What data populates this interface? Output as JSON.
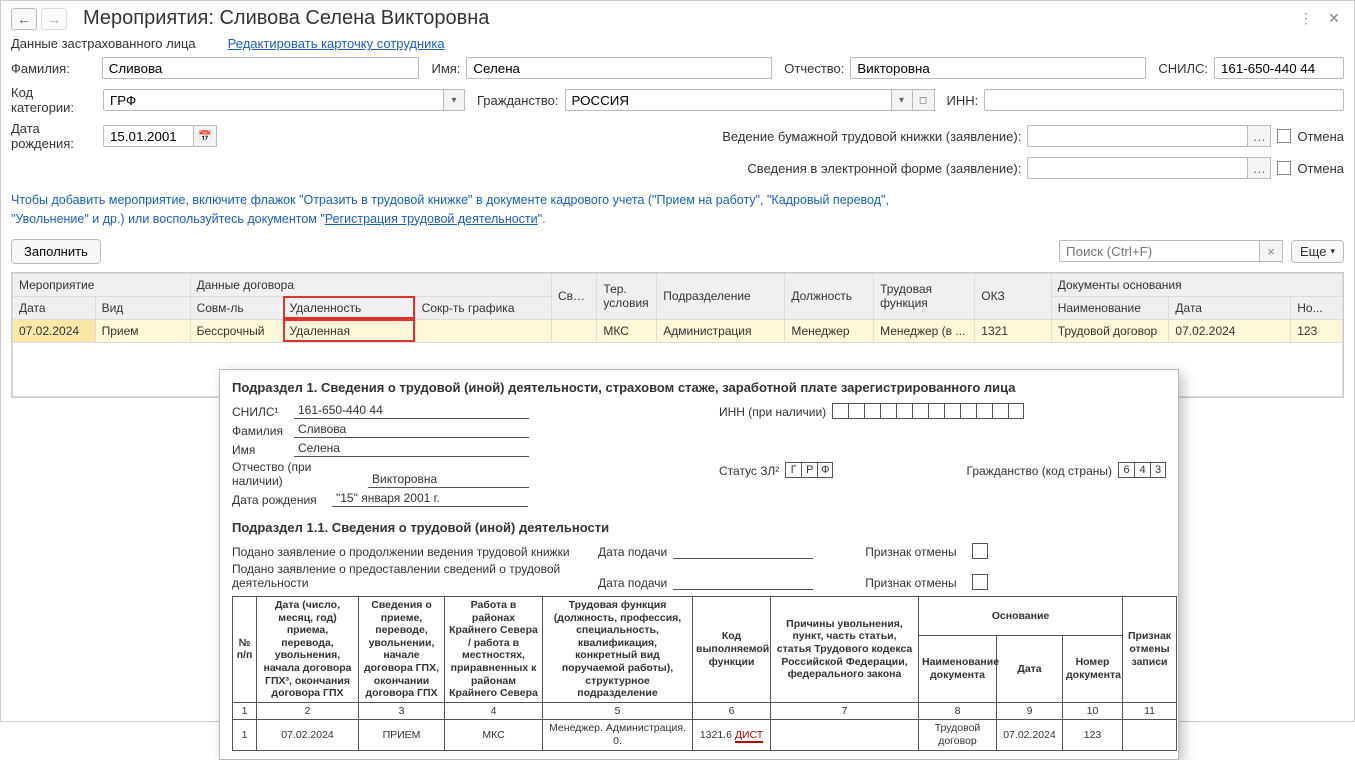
{
  "header": {
    "title": "Мероприятия: Сливова Селена Викторовна"
  },
  "insured": {
    "section_label": "Данные застрахованного лица",
    "edit_link": "Редактировать карточку сотрудника",
    "surname_label": "Фамилия:",
    "surname": "Сливова",
    "name_label": "Имя:",
    "name": "Селена",
    "patronymic_label": "Отчество:",
    "patronymic": "Викторовна",
    "snils_label": "СНИЛС:",
    "snils": "161-650-440 44",
    "category_label": "Код категории:",
    "category": "ГРФ",
    "citizenship_label": "Гражданство:",
    "citizenship": "РОССИЯ",
    "inn_label": "ИНН:",
    "inn": "",
    "dob_label": "Дата рождения:",
    "dob": "15.01.2001",
    "paper_label": "Ведение бумажной трудовой книжки (заявление):",
    "electronic_label": "Сведения в электронной форме (заявление):",
    "cancel_label": "Отмена"
  },
  "hint": {
    "line1": "Чтобы добавить мероприятие, включите флажок \"Отразить в трудовой книжке\" в документе кадрового учета (\"Прием на работу\", \"Кадровый перевод\",",
    "line2_prefix": "\"Увольнение\" и др.) или воспользуйтесь документом \"",
    "line2_link": "Регистрация трудовой деятельности",
    "line2_suffix": "\"."
  },
  "toolbar": {
    "fill": "Заполнить",
    "search_placeholder": "Поиск (Ctrl+F)",
    "more": "Еще"
  },
  "grid": {
    "group_event": "Мероприятие",
    "group_contract": "Данные договора",
    "group_docs": "Документы основания",
    "col_date": "Дата",
    "col_vid": "Вид",
    "col_sovm": "Совм-ль",
    "col_udal": "Удаленность",
    "col_sokr": "Сокр-ть графика",
    "col_sved": "Сведения",
    "col_ter": "Тер. условия",
    "col_podr": "Подразделение",
    "col_dolz": "Должность",
    "col_trud": "Трудовая функция",
    "col_okz": "ОКЗ",
    "col_dok_naim": "Наименование",
    "col_dok_data": "Дата",
    "col_dok_no": "Но...",
    "rows": [
      {
        "date": "07.02.2024",
        "vid": "Прием",
        "sovm": "Бессрочный",
        "udal": "Удаленная",
        "sokr": "",
        "sved": "",
        "ter": "МКС",
        "podr": "Администрация",
        "dolz": "Менеджер",
        "trud": "Менеджер (в ...",
        "okz": "1321",
        "dok_naim": "Трудовой договор",
        "dok_data": "07.02.2024",
        "dok_no": "123"
      }
    ]
  },
  "sub": {
    "title": "Подраздел 1. Сведения о трудовой (иной) деятельности, страховом стаже, заработной плате зарегистрированного лица",
    "snils_label": "СНИЛС¹",
    "snils": "161-650-440 44",
    "surname_label": "Фамилия",
    "surname": "Сливова",
    "name_label": "Имя",
    "name": "Селена",
    "patronymic_label": "Отчество (при наличии)",
    "patronymic": "Викторовна",
    "dob_label": "Дата рождения",
    "dob": "\"15\" января 2001 г.",
    "inn_label": "ИНН (при наличии)",
    "status_label": "Статус ЗЛ²",
    "status_boxes": [
      "Г",
      "Р",
      "Ф"
    ],
    "citizenship_label": "Гражданство (код страны)",
    "citizenship_boxes": [
      "6",
      "4",
      "3"
    ],
    "sub11_title": "Подраздел 1.1. Сведения о трудовой (иной) деятельности",
    "paper_app": "Подано заявление о продолжении ведения трудовой книжки",
    "electronic_app": "Подано заявление о предоставлении сведений о трудовой деятельности",
    "date_submit": "Дата подачи",
    "cancel_flag": "Признак отмены",
    "rep_headers": {
      "npp": "№ п/п",
      "date": "Дата (число, месяц, год) приема, перевода, увольнения, начала договора ГПХ³, окончания договора ГПХ",
      "event": "Сведения о приеме, переводе, увольнении, начале договора ГПХ, окончании договора ГПХ",
      "north": "Работа в районах Крайнего Севера / работа в местностях, приравненных к районам Крайнего Севера",
      "func": "Трудовая функция (должность, профессия, специальность, квалификация, конкретный вид поручаемой работы), структурное подразделение",
      "code": "Код выполняемой функции",
      "reason": "Причины увольнения, пункт, часть статьи, статья Трудового кодекса Российской Федерации, федерального закона",
      "basis": "Основание",
      "docname": "Наименование документа",
      "docdate": "Дата",
      "docno": "Номер документа",
      "cancel": "Признак отмены записи"
    },
    "rep_nums": [
      "1",
      "2",
      "3",
      "4",
      "5",
      "6",
      "7",
      "8",
      "9",
      "10",
      "11"
    ],
    "rep_row": {
      "npp": "1",
      "date": "07.02.2024",
      "event": "ПРИЕМ",
      "north": "МКС",
      "func": "Менеджер. Администрация. 0.",
      "code_num": "1321.6",
      "code_dist": "ДИСТ",
      "reason": "",
      "docname": "Трудовой договор",
      "docdate": "07.02.2024",
      "docno": "123",
      "cancel": ""
    }
  }
}
